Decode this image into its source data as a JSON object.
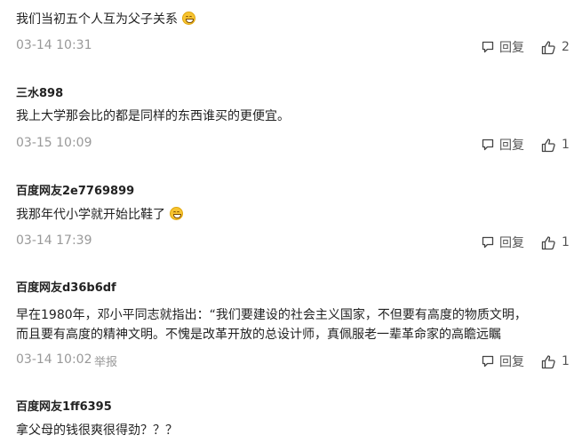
{
  "comments": [
    {
      "author": "",
      "text": "我们当初五个人互为父子关系",
      "emoji": "grin-emoji",
      "time": "03-14 10:31",
      "report": "",
      "reply_label": "回复",
      "likes": "2"
    },
    {
      "author": "三水898",
      "text": "我上大学那会比的都是同样的东西谁买的更便宜。",
      "emoji": "",
      "time": "03-15 10:09",
      "report": "",
      "reply_label": "回复",
      "likes": "1"
    },
    {
      "author": "百度网友2e7769899",
      "text": "我那年代小学就开始比鞋了",
      "emoji": "grin-emoji",
      "time": "03-14 17:39",
      "report": "",
      "reply_label": "回复",
      "likes": "1"
    },
    {
      "author": "百度网友d36b6df",
      "text_line1": "早在1980年，邓小平同志就指出：“我们要建设的社会主义国家，不但要有高度的物质文明，",
      "text_line2": "而且要有高度的精神文明。不愧是改革开放的总设计师，真佩服老一辈革命家的高瞻远瞩",
      "time": "03-14 10:02",
      "report": "举报",
      "reply_label": "回复",
      "likes": "1"
    },
    {
      "author": "百度网友1ff6395",
      "text": "拿父母的钱很爽很得劲？？？"
    }
  ],
  "colors": {
    "text": "#222222",
    "meta": "#999999",
    "action": "#555555",
    "emoji": "#f7c431"
  },
  "icons": {
    "reply": "comment-bubble-icon",
    "like": "thumbs-up-icon"
  }
}
